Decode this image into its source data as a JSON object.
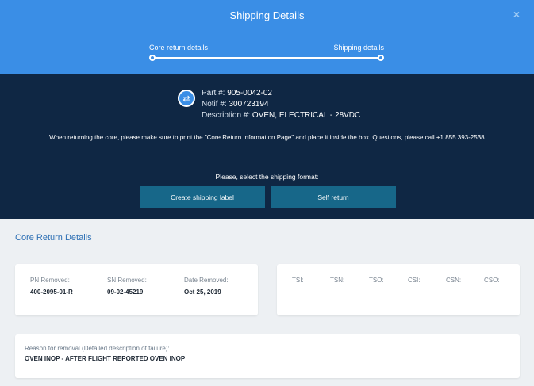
{
  "header": {
    "title": "Shipping Details",
    "close_icon": "×",
    "steps": [
      {
        "label": "Core return details"
      },
      {
        "label": "Shipping details"
      }
    ]
  },
  "part_info": {
    "part_label": "Part #:",
    "part_value": "905-0042-02",
    "notif_label": "Notif #:",
    "notif_value": "300723194",
    "description_label": "Description #:",
    "description_value": "OVEN, ELECTRICAL - 28VDC",
    "notice": "When returning the core, please make sure to print the \"Core Return Information Page\" and place it inside the box. Questions, please call +1 855 393-2538.",
    "shipping_prompt": "Please, select the shipping format:",
    "create_label_button": "Create shipping label",
    "self_return_button": "Self return"
  },
  "core_return": {
    "section_title": "Core Return Details",
    "fields": [
      {
        "label": "PN Removed:",
        "value": "400-2095-01-R"
      },
      {
        "label": "SN Removed:",
        "value": "09-02-45219"
      },
      {
        "label": "Date Removed:",
        "value": "Oct 25, 2019"
      }
    ],
    "stats": [
      "TSI:",
      "TSN:",
      "TSO:",
      "CSI:",
      "CSN:",
      "CSO:"
    ],
    "reason_label": "Reason for removal (Detailed description of failure):",
    "reason_value": "OVEN INOP - AFTER FLIGHT REPORTED OVEN INOP"
  },
  "colors": {
    "header_bg": "#3a8ee6",
    "info_bg": "#0f2744",
    "button_bg": "#176789",
    "section_title": "#2d6fb4",
    "page_bg": "#edf0f3"
  },
  "icons": {
    "close": "close-icon",
    "swap": "swap-arrows-icon"
  }
}
